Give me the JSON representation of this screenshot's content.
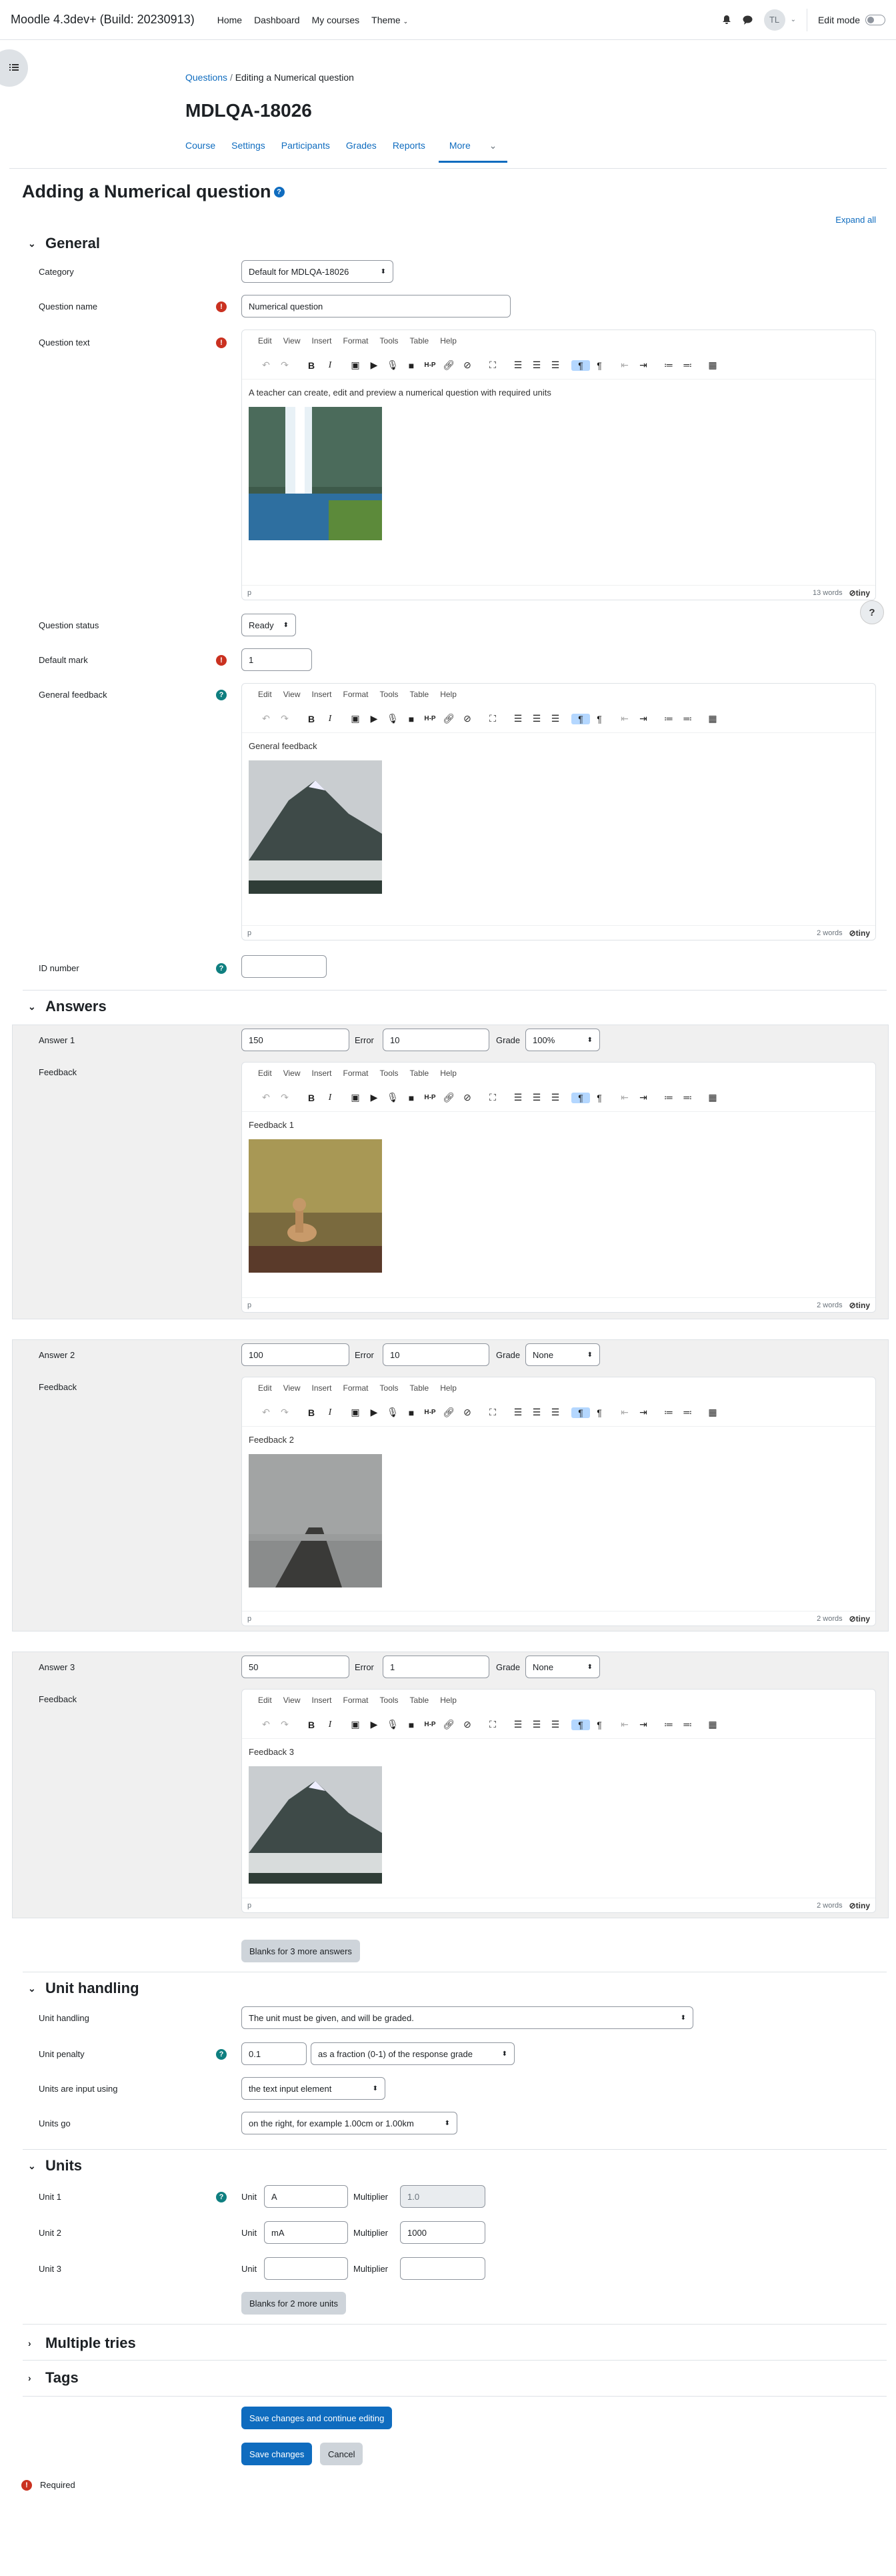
{
  "navbar": {
    "brand": "Moodle 4.3dev+ (Build: 20230913)",
    "links": [
      "Home",
      "Dashboard",
      "My courses",
      "Theme"
    ],
    "avatar": "TL",
    "edit_mode": "Edit mode"
  },
  "breadcrumb": {
    "root": "Questions",
    "sep": "/",
    "current": "Editing a Numerical question"
  },
  "course_title": "MDLQA-18026",
  "secnav": [
    "Course",
    "Settings",
    "Participants",
    "Grades",
    "Reports",
    "More"
  ],
  "page_title": "Adding a Numerical question",
  "expand_all": "Expand all",
  "general": {
    "heading": "General",
    "category_label": "Category",
    "category_value": "Default for MDLQA-18026",
    "qname_label": "Question name",
    "qname_value": "Numerical question",
    "qtext_label": "Question text",
    "qtext_content": "A teacher can create, edit and preview a numerical question with required units",
    "qtext_words": "13 words",
    "status_label": "Question status",
    "status_value": "Ready",
    "mark_label": "Default mark",
    "mark_value": "1",
    "feedback_label": "General feedback",
    "feedback_content": "General feedback",
    "feedback_words": "2 words",
    "id_label": "ID number"
  },
  "editor": {
    "menus": [
      "Edit",
      "View",
      "Insert",
      "Format",
      "Tools",
      "Table",
      "Help"
    ],
    "path": "p",
    "brand": "tiny"
  },
  "answers": {
    "heading": "Answers",
    "error_label": "Error",
    "grade_label": "Grade",
    "feedback_label": "Feedback",
    "items": [
      {
        "label": "Answer 1",
        "value": "150",
        "error": "10",
        "grade": "100%",
        "feedback": "Feedback 1",
        "words": "2 words"
      },
      {
        "label": "Answer 2",
        "value": "100",
        "error": "10",
        "grade": "None",
        "feedback": "Feedback 2",
        "words": "2 words"
      },
      {
        "label": "Answer 3",
        "value": "50",
        "error": "1",
        "grade": "None",
        "feedback": "Feedback 3",
        "words": "2 words"
      }
    ],
    "blanks": "Blanks for 3 more answers"
  },
  "unit_handling": {
    "heading": "Unit handling",
    "handling_label": "Unit handling",
    "handling_value": "The unit must be given, and will be graded.",
    "penalty_label": "Unit penalty",
    "penalty_value": "0.1",
    "penalty_type": "as a fraction (0-1) of the response grade",
    "input_label": "Units are input using",
    "input_value": "the text input element",
    "go_label": "Units go",
    "go_value": "on the right, for example 1.00cm or 1.00km"
  },
  "units": {
    "heading": "Units",
    "unit_label": "Unit",
    "mult_label": "Multiplier",
    "items": [
      {
        "label": "Unit 1",
        "unit": "A",
        "mult": "1.0"
      },
      {
        "label": "Unit 2",
        "unit": "mA",
        "mult": "1000"
      },
      {
        "label": "Unit 3",
        "unit": "",
        "mult": ""
      }
    ],
    "blanks": "Blanks for 2 more units"
  },
  "multiple_tries": "Multiple tries",
  "tags": "Tags",
  "buttons": {
    "save_continue": "Save changes and continue editing",
    "save": "Save changes",
    "cancel": "Cancel"
  },
  "required": "Required"
}
